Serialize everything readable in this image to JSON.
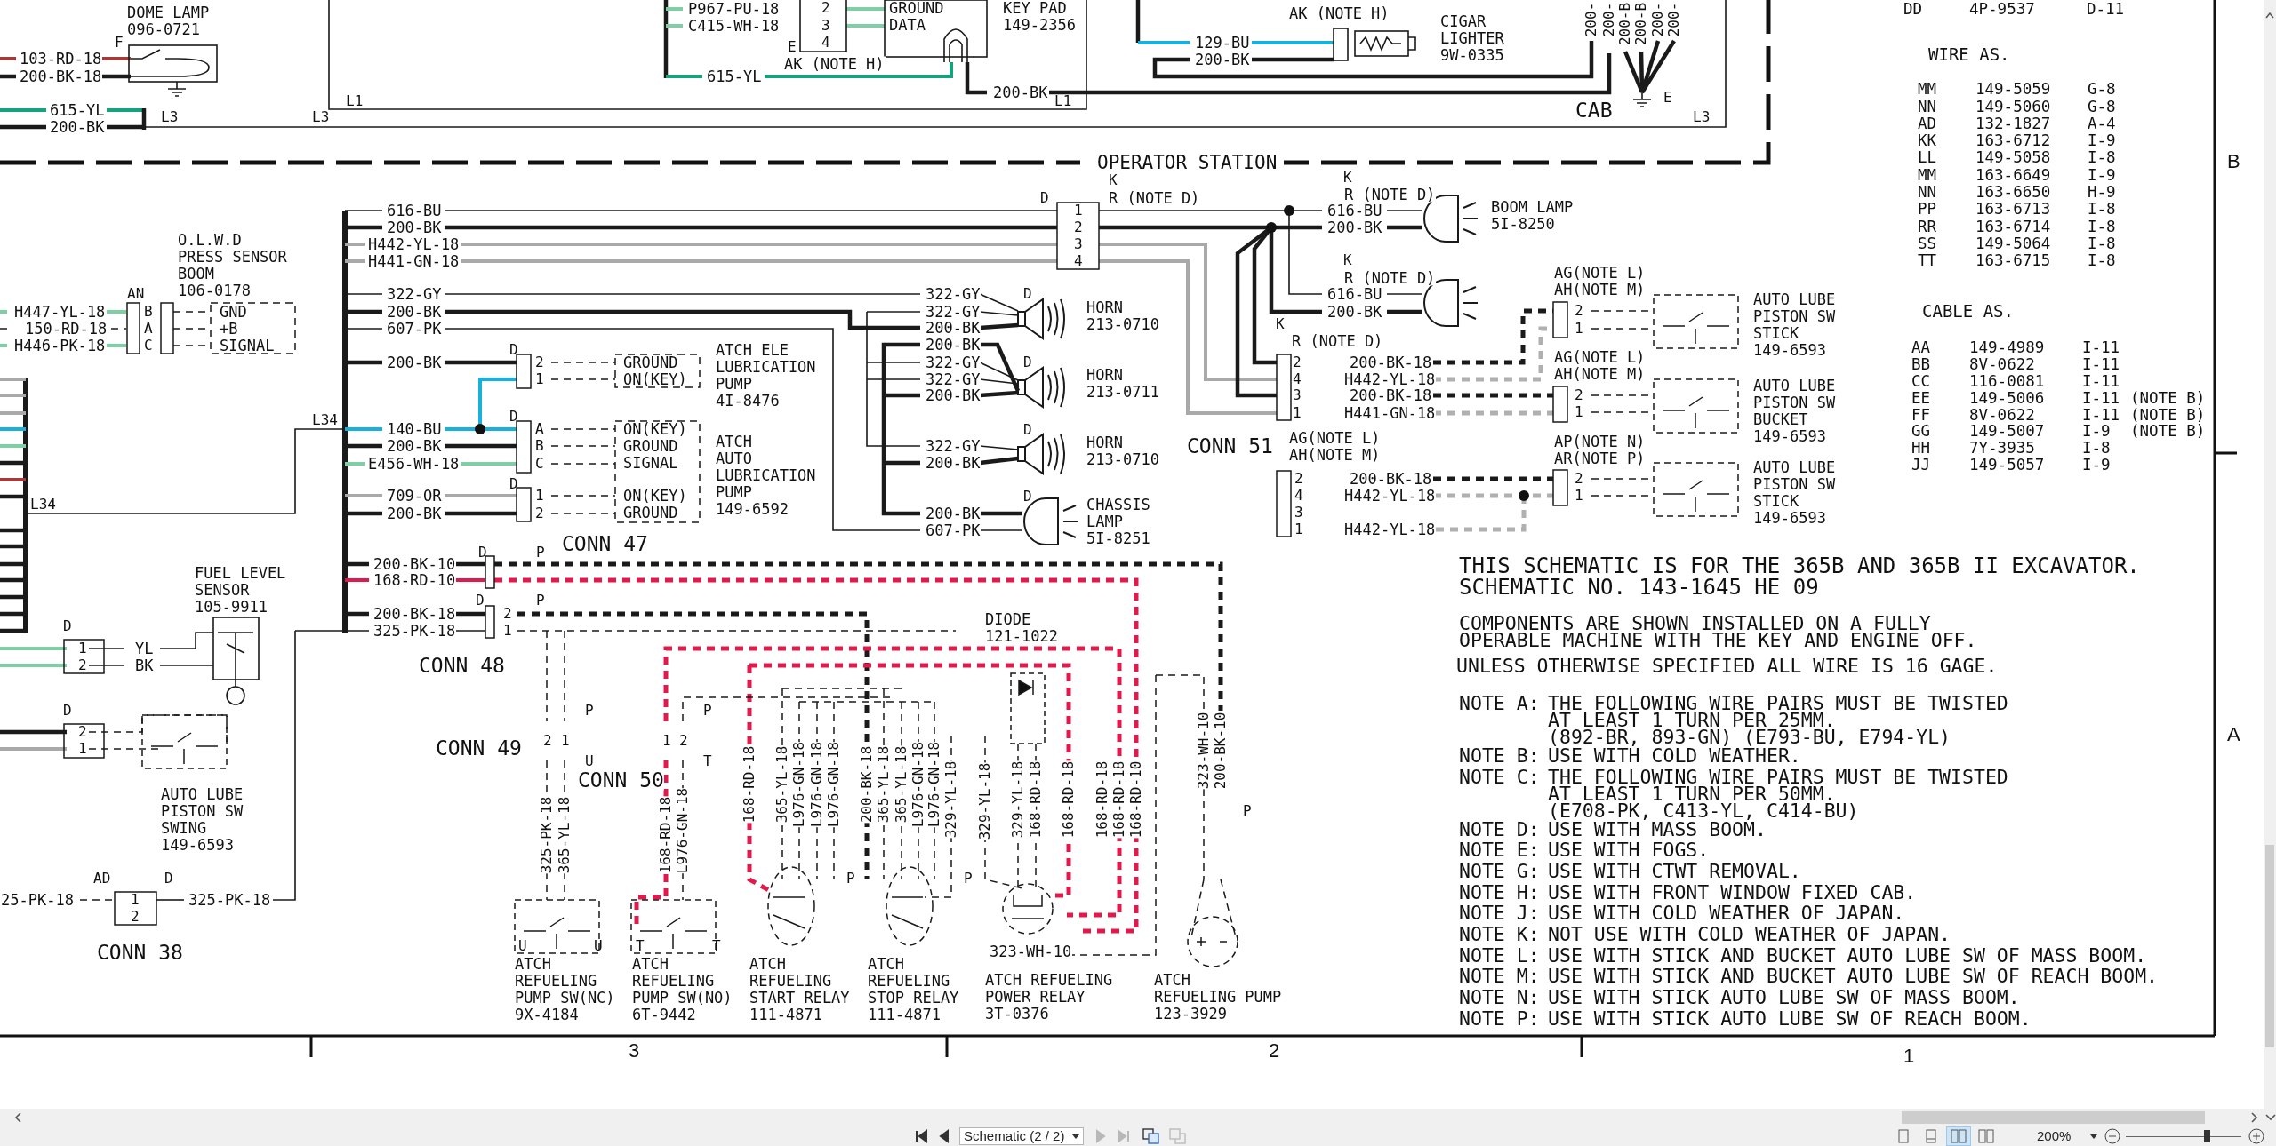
{
  "schematic": {
    "labels": [
      {
        "kind": "name",
        "lines": [
          "DOME LAMP",
          "096-0721"
        ]
      },
      {
        "kind": "pin",
        "text": "F"
      },
      {
        "kind": "wire",
        "text": "103-RD-18"
      },
      {
        "kind": "wire",
        "text": "200-BK-18"
      },
      {
        "kind": "wire",
        "text": "615-YL"
      },
      {
        "kind": "wire",
        "text": "200-BK"
      },
      {
        "kind": "pin",
        "text": "L3"
      },
      {
        "kind": "pin",
        "text": "L3"
      },
      {
        "kind": "pin",
        "text": "L1"
      },
      {
        "kind": "wire",
        "text": "P967-PU-18"
      },
      {
        "kind": "wire",
        "text": "C415-WH-18"
      },
      {
        "kind": "wire",
        "text": "615-YL"
      },
      {
        "kind": "pin",
        "text": "2"
      },
      {
        "kind": "pin",
        "text": "3"
      },
      {
        "kind": "pin",
        "text": "4"
      },
      {
        "kind": "pin",
        "text": "E"
      },
      {
        "kind": "wire",
        "text": "AK (NOTE H)"
      },
      {
        "kind": "name",
        "lines": [
          "GROUND",
          "DATA"
        ]
      },
      {
        "kind": "name",
        "lines": [
          "KEY PAD",
          "149-2356"
        ]
      },
      {
        "kind": "wire",
        "text": "200-BK"
      },
      {
        "kind": "pin",
        "text": "L1"
      },
      {
        "kind": "wire",
        "text": "AK (NOTE H)"
      },
      {
        "kind": "wire",
        "text": "129-BU"
      },
      {
        "kind": "wire",
        "text": "200-BK"
      },
      {
        "kind": "name",
        "lines": [
          "CIGAR",
          "LIGHTER",
          "9W-0335"
        ]
      },
      {
        "kind": "vwire",
        "text": "200-"
      },
      {
        "kind": "vwire",
        "text": "200-"
      },
      {
        "kind": "vwire",
        "text": "200-B"
      },
      {
        "kind": "vwire",
        "text": "200-B"
      },
      {
        "kind": "vwire",
        "text": "200-"
      },
      {
        "kind": "vwire",
        "text": "200-"
      },
      {
        "kind": "conn",
        "text": "CAB"
      },
      {
        "kind": "pin",
        "text": "E"
      },
      {
        "kind": "pin",
        "text": "L3"
      },
      {
        "kind": "title",
        "text": "OPERATOR STATION"
      },
      {
        "kind": "wire",
        "text": "616-BU"
      },
      {
        "kind": "wire",
        "text": "200-BK"
      },
      {
        "kind": "wire",
        "text": "H442-YL-18"
      },
      {
        "kind": "wire",
        "text": "H441-GN-18"
      },
      {
        "kind": "wire",
        "text": "322-GY"
      },
      {
        "kind": "wire",
        "text": "200-BK"
      },
      {
        "kind": "wire",
        "text": "607-PK"
      },
      {
        "kind": "wire",
        "text": "200-BK"
      },
      {
        "kind": "wire",
        "text": "140-BU"
      },
      {
        "kind": "wire",
        "text": "200-BK"
      },
      {
        "kind": "wire",
        "text": "E456-WH-18"
      },
      {
        "kind": "wire",
        "text": "709-OR"
      },
      {
        "kind": "wire",
        "text": "200-BK"
      },
      {
        "kind": "wire",
        "text": "200-BK-10"
      },
      {
        "kind": "wire",
        "text": "168-RD-10"
      },
      {
        "kind": "wire",
        "text": "200-BK-18"
      },
      {
        "kind": "wire",
        "text": "325-PK-18"
      },
      {
        "kind": "pin",
        "text": "L34"
      },
      {
        "kind": "pin",
        "text": "L34"
      },
      {
        "kind": "pin",
        "text": "AN"
      },
      {
        "kind": "name",
        "lines": [
          "O.L.W.D",
          "PRESS SENSOR",
          "BOOM",
          "106-0178"
        ]
      },
      {
        "kind": "wire",
        "text": "H447-YL-18"
      },
      {
        "kind": "wire",
        "text": "150-RD-18"
      },
      {
        "kind": "wire",
        "text": "H446-PK-18"
      },
      {
        "kind": "pin",
        "text": "B"
      },
      {
        "kind": "pin",
        "text": "A"
      },
      {
        "kind": "pin",
        "text": "C"
      },
      {
        "kind": "name",
        "lines": [
          "GND",
          "+B",
          "SIGNAL"
        ]
      },
      {
        "kind": "pin",
        "text": "D"
      },
      {
        "kind": "pin",
        "text": "2"
      },
      {
        "kind": "pin",
        "text": "1"
      },
      {
        "kind": "name",
        "lines": [
          "GROUND",
          "ON(KEY)"
        ]
      },
      {
        "kind": "name",
        "lines": [
          "ATCH ELE",
          "LUBRICATION",
          "PUMP",
          "4I-8476"
        ]
      },
      {
        "kind": "pin",
        "text": "D"
      },
      {
        "kind": "pin",
        "text": "A"
      },
      {
        "kind": "pin",
        "text": "B"
      },
      {
        "kind": "pin",
        "text": "C"
      },
      {
        "kind": "pin",
        "text": "D"
      },
      {
        "kind": "pin",
        "text": "1"
      },
      {
        "kind": "pin",
        "text": "2"
      },
      {
        "kind": "name",
        "lines": [
          "ON(KEY)",
          "GROUND",
          "SIGNAL"
        ]
      },
      {
        "kind": "name",
        "lines": [
          "ON(KEY)",
          "GROUND"
        ]
      },
      {
        "kind": "name",
        "lines": [
          "ATCH",
          "AUTO",
          "LUBRICATION",
          "PUMP",
          "149-6592"
        ]
      },
      {
        "kind": "conn",
        "text": "CONN 47"
      },
      {
        "kind": "pin",
        "text": "D"
      },
      {
        "kind": "pin",
        "text": "P"
      },
      {
        "kind": "pin",
        "text": "D"
      },
      {
        "kind": "pin",
        "text": "P"
      },
      {
        "kind": "pin",
        "text": "2"
      },
      {
        "kind": "pin",
        "text": "1"
      },
      {
        "kind": "conn",
        "text": "CONN 48"
      },
      {
        "kind": "name",
        "lines": [
          "FUEL LEVEL",
          "SENSOR",
          "105-9911"
        ]
      },
      {
        "kind": "pin",
        "text": "D"
      },
      {
        "kind": "pin",
        "text": "1"
      },
      {
        "kind": "pin",
        "text": "2"
      },
      {
        "kind": "wire",
        "text": "YL"
      },
      {
        "kind": "wire",
        "text": "BK"
      },
      {
        "kind": "pin",
        "text": "D"
      },
      {
        "kind": "pin",
        "text": "2"
      },
      {
        "kind": "pin",
        "text": "1"
      },
      {
        "kind": "name",
        "lines": [
          "AUTO LUBE",
          "PISTON SW",
          "SWING",
          "149-6593"
        ]
      },
      {
        "kind": "pin",
        "text": "AD"
      },
      {
        "kind": "pin",
        "text": "D"
      },
      {
        "kind": "wire",
        "text": "25-PK-18"
      },
      {
        "kind": "pin",
        "text": "1"
      },
      {
        "kind": "pin",
        "text": "2"
      },
      {
        "kind": "wire",
        "text": "325-PK-18"
      },
      {
        "kind": "conn",
        "text": "CONN 38"
      },
      {
        "kind": "pin",
        "text": "P"
      },
      {
        "kind": "pin",
        "text": "2"
      },
      {
        "kind": "pin",
        "text": "1"
      },
      {
        "kind": "pin",
        "text": "U"
      },
      {
        "kind": "conn",
        "text": "CONN 49"
      },
      {
        "kind": "vwire",
        "text": "325-PK-18"
      },
      {
        "kind": "vwire",
        "text": "365-YL-18"
      },
      {
        "kind": "pin",
        "text": "1"
      },
      {
        "kind": "pin",
        "text": "2"
      },
      {
        "kind": "pin",
        "text": "P"
      },
      {
        "kind": "pin",
        "text": "T"
      },
      {
        "kind": "conn",
        "text": "CONN 50"
      },
      {
        "kind": "vwire",
        "text": "168-RD-18"
      },
      {
        "kind": "vwire",
        "text": "L976-GN-18"
      },
      {
        "kind": "pin",
        "text": "U"
      },
      {
        "kind": "pin",
        "text": "U"
      },
      {
        "kind": "pin",
        "text": "T"
      },
      {
        "kind": "pin",
        "text": "T"
      },
      {
        "kind": "name",
        "lines": [
          "ATCH",
          "REFUELING",
          "PUMP SW(NC)",
          "9X-4184"
        ]
      },
      {
        "kind": "name",
        "lines": [
          "ATCH",
          "REFUELING",
          "PUMP SW(NO)",
          "6T-9442"
        ]
      },
      {
        "kind": "vwire",
        "text": "168-RD-18"
      },
      {
        "kind": "vwire",
        "text": "365-YL-18"
      },
      {
        "kind": "vwire",
        "text": "L976-GN-18"
      },
      {
        "kind": "vwire",
        "text": "L976-GN-18"
      },
      {
        "kind": "vwire",
        "text": "L976-GN-18"
      },
      {
        "kind": "vwire",
        "text": "200-BK-18"
      },
      {
        "kind": "vwire",
        "text": "365-YL-18"
      },
      {
        "kind": "vwire",
        "text": "365-YL-18"
      },
      {
        "kind": "vwire",
        "text": "L976-GN-18"
      },
      {
        "kind": "vwire",
        "text": "L976-GN-18"
      },
      {
        "kind": "vwire",
        "text": "329-YL-18"
      },
      {
        "kind": "vwire",
        "text": "329-YL-18"
      },
      {
        "kind": "vwire",
        "text": "329-YL-18"
      },
      {
        "kind": "vwire",
        "text": "168-RD-18"
      },
      {
        "kind": "vwire",
        "text": "168-RD-18"
      },
      {
        "kind": "vwire",
        "text": "168-RD-18"
      },
      {
        "kind": "vwire",
        "text": "168-RD-18"
      },
      {
        "kind": "vwire",
        "text": "168-RD-10"
      },
      {
        "kind": "vwire",
        "text": "323-WH-10"
      },
      {
        "kind": "vwire",
        "text": "200-BK-10"
      },
      {
        "kind": "pin",
        "text": "P"
      },
      {
        "kind": "pin",
        "text": "P"
      },
      {
        "kind": "pin",
        "text": "P"
      },
      {
        "kind": "name",
        "lines": [
          "DIODE",
          "121-1022"
        ]
      },
      {
        "kind": "wire",
        "text": "323-WH-10"
      },
      {
        "kind": "name",
        "lines": [
          "ATCH",
          "REFUELING",
          "START RELAY",
          "111-4871"
        ]
      },
      {
        "kind": "name",
        "lines": [
          "ATCH",
          "REFUELING",
          "STOP RELAY",
          "111-4871"
        ]
      },
      {
        "kind": "name",
        "lines": [
          "ATCH REFUELING",
          "POWER RELAY",
          "3T-0376"
        ]
      },
      {
        "kind": "name",
        "lines": [
          "ATCH",
          "REFUELING PUMP",
          "123-3929"
        ]
      },
      {
        "kind": "pin",
        "text": "D"
      },
      {
        "kind": "pin",
        "text": "K"
      },
      {
        "kind": "wire",
        "text": "R (NOTE D)"
      },
      {
        "kind": "pin",
        "text": "1"
      },
      {
        "kind": "pin",
        "text": "2"
      },
      {
        "kind": "pin",
        "text": "3"
      },
      {
        "kind": "pin",
        "text": "4"
      },
      {
        "kind": "pin",
        "text": "K"
      },
      {
        "kind": "wire",
        "text": "R (NOTE D)"
      },
      {
        "kind": "wire",
        "text": "616-BU"
      },
      {
        "kind": "wire",
        "text": "200-BK"
      },
      {
        "kind": "name",
        "lines": [
          "BOOM LAMP",
          "5I-8250"
        ]
      },
      {
        "kind": "pin",
        "text": "K"
      },
      {
        "kind": "wire",
        "text": "R (NOTE D)"
      },
      {
        "kind": "wire",
        "text": "616-BU"
      },
      {
        "kind": "wire",
        "text": "200-BK"
      },
      {
        "kind": "wire",
        "text": "322-GY"
      },
      {
        "kind": "wire",
        "text": "322-GY"
      },
      {
        "kind": "wire",
        "text": "200-BK"
      },
      {
        "kind": "wire",
        "text": "200-BK"
      },
      {
        "kind": "wire",
        "text": "322-GY"
      },
      {
        "kind": "wire",
        "text": "322-GY"
      },
      {
        "kind": "wire",
        "text": "200-BK"
      },
      {
        "kind": "wire",
        "text": "322-GY"
      },
      {
        "kind": "wire",
        "text": "200-BK"
      },
      {
        "kind": "wire",
        "text": "200-BK"
      },
      {
        "kind": "wire",
        "text": "607-PK"
      },
      {
        "kind": "pin",
        "text": "D"
      },
      {
        "kind": "pin",
        "text": "D"
      },
      {
        "kind": "pin",
        "text": "D"
      },
      {
        "kind": "pin",
        "text": "D"
      },
      {
        "kind": "name",
        "lines": [
          "HORN",
          "213-0710"
        ]
      },
      {
        "kind": "name",
        "lines": [
          "HORN",
          "213-0711"
        ]
      },
      {
        "kind": "name",
        "lines": [
          "HORN",
          "213-0710"
        ]
      },
      {
        "kind": "name",
        "lines": [
          "CHASSIS",
          "LAMP",
          "5I-8251"
        ]
      },
      {
        "kind": "pin",
        "text": "K"
      },
      {
        "kind": "wire",
        "text": "R (NOTE D)"
      },
      {
        "kind": "pin",
        "text": "2"
      },
      {
        "kind": "pin",
        "text": "4"
      },
      {
        "kind": "pin",
        "text": "3"
      },
      {
        "kind": "pin",
        "text": "1"
      },
      {
        "kind": "wire",
        "text": "200-BK-18"
      },
      {
        "kind": "wire",
        "text": "H442-YL-18"
      },
      {
        "kind": "wire",
        "text": "200-BK-18"
      },
      {
        "kind": "wire",
        "text": "H441-GN-18"
      },
      {
        "kind": "conn",
        "text": "CONN 51"
      },
      {
        "kind": "wire",
        "text": "AG(NOTE L)"
      },
      {
        "kind": "wire",
        "text": "AH(NOTE M)"
      },
      {
        "kind": "pin",
        "text": "2"
      },
      {
        "kind": "pin",
        "text": "4"
      },
      {
        "kind": "pin",
        "text": "3"
      },
      {
        "kind": "pin",
        "text": "1"
      },
      {
        "kind": "wire",
        "text": "200-BK-18"
      },
      {
        "kind": "wire",
        "text": "H442-YL-18"
      },
      {
        "kind": "wire",
        "text": "H442-YL-18"
      },
      {
        "kind": "wire",
        "text": "AG(NOTE L)"
      },
      {
        "kind": "wire",
        "text": "AH(NOTE M)"
      },
      {
        "kind": "pin",
        "text": "2"
      },
      {
        "kind": "pin",
        "text": "1"
      },
      {
        "kind": "name",
        "lines": [
          "AUTO LUBE",
          "PISTON SW",
          "STICK",
          "149-6593"
        ]
      },
      {
        "kind": "wire",
        "text": "AG(NOTE L)"
      },
      {
        "kind": "wire",
        "text": "AH(NOTE M)"
      },
      {
        "kind": "pin",
        "text": "2"
      },
      {
        "kind": "pin",
        "text": "1"
      },
      {
        "kind": "name",
        "lines": [
          "AUTO LUBE",
          "PISTON SW",
          "BUCKET",
          "149-6593"
        ]
      },
      {
        "kind": "wire",
        "text": "AP(NOTE N)"
      },
      {
        "kind": "wire",
        "text": "AR(NOTE P)"
      },
      {
        "kind": "pin",
        "text": "2"
      },
      {
        "kind": "pin",
        "text": "1"
      },
      {
        "kind": "name",
        "lines": [
          "AUTO LUBE",
          "PISTON SW",
          "STICK",
          "149-6593"
        ]
      },
      {
        "kind": "grid",
        "text": "B"
      },
      {
        "kind": "grid",
        "text": "A"
      },
      {
        "kind": "grid",
        "text": "3"
      },
      {
        "kind": "grid",
        "text": "2"
      },
      {
        "kind": "grid",
        "text": "1"
      }
    ]
  },
  "previous_table_rows": [
    {
      "code": "DD",
      "part": "4P-9537",
      "zone": "D-11"
    }
  ],
  "wire_table": {
    "title": "WIRE AS.",
    "rows": [
      {
        "code": "MM",
        "part": "149-5059",
        "zone": "G-8"
      },
      {
        "code": "NN",
        "part": "149-5060",
        "zone": "G-8"
      },
      {
        "code": "AD",
        "part": "132-1827",
        "zone": "A-4"
      },
      {
        "code": "KK",
        "part": "163-6712",
        "zone": "I-9"
      },
      {
        "code": "LL",
        "part": "149-5058",
        "zone": "I-8"
      },
      {
        "code": "MM",
        "part": "163-6649",
        "zone": "I-9"
      },
      {
        "code": "NN",
        "part": "163-6650",
        "zone": "H-9"
      },
      {
        "code": "PP",
        "part": "163-6713",
        "zone": "I-8"
      },
      {
        "code": "RR",
        "part": "163-6714",
        "zone": "I-8"
      },
      {
        "code": "SS",
        "part": "149-5064",
        "zone": "I-8"
      },
      {
        "code": "TT",
        "part": "163-6715",
        "zone": "I-8"
      }
    ]
  },
  "cable_table": {
    "title": "CABLE AS.",
    "rows": [
      {
        "code": "AA",
        "part": "149-4989",
        "zone": "I-11"
      },
      {
        "code": "BB",
        "part": "8V-0622",
        "zone": "I-11"
      },
      {
        "code": "CC",
        "part": "116-0081",
        "zone": "I-11"
      },
      {
        "code": "EE",
        "part": "149-5006",
        "zone": "I-11",
        "note": "(NOTE B)"
      },
      {
        "code": "FF",
        "part": "8V-0622",
        "zone": "I-11",
        "note": "(NOTE B)"
      },
      {
        "code": "GG",
        "part": "149-5007",
        "zone": "I-9",
        "note": "(NOTE B)"
      },
      {
        "code": "HH",
        "part": "7Y-3935",
        "zone": "I-8"
      },
      {
        "code": "JJ",
        "part": "149-5057",
        "zone": "I-9"
      }
    ]
  },
  "notes": {
    "heading": [
      "THIS SCHEMATIC IS FOR THE 365B AND 365B II EXCAVATOR.",
      "SCHEMATIC NO. 143-1645 HE 09"
    ],
    "conditions": [
      "COMPONENTS ARE SHOWN INSTALLED ON A FULLY",
      "OPERABLE MACHINE WITH THE KEY AND ENGINE OFF."
    ],
    "gage": "UNLESS OTHERWISE SPECIFIED ALL WIRE IS 16 GAGE.",
    "items": [
      {
        "label": "NOTE A:",
        "lines": [
          "THE FOLLOWING WIRE PAIRS MUST BE TWISTED",
          "AT LEAST 1 TURN PER 25MM.",
          "(892-BR, 893-GN) (E793-BU, E794-YL)"
        ]
      },
      {
        "label": "NOTE B:",
        "lines": [
          "USE WITH COLD WEATHER."
        ]
      },
      {
        "label": "NOTE C:",
        "lines": [
          "THE FOLLOWING WIRE PAIRS MUST BE TWISTED",
          "AT LEAST 1 TURN PER 50MM.",
          "(E708-PK, C413-YL, C414-BU)"
        ]
      },
      {
        "label": "NOTE D:",
        "lines": [
          "USE WITH MASS BOOM."
        ]
      },
      {
        "label": "NOTE E:",
        "lines": [
          "USE WITH FOGS."
        ]
      },
      {
        "label": "NOTE G:",
        "lines": [
          "USE WITH CTWT REMOVAL."
        ]
      },
      {
        "label": "NOTE H:",
        "lines": [
          "USE WITH FRONT WINDOW FIXED CAB."
        ]
      },
      {
        "label": "NOTE J:",
        "lines": [
          "USE WITH COLD WEATHER OF JAPAN."
        ]
      },
      {
        "label": "NOTE K:",
        "lines": [
          "NOT USE WITH COLD WEATHER OF JAPAN."
        ]
      },
      {
        "label": "NOTE L:",
        "lines": [
          "USE WITH STICK AND BUCKET AUTO LUBE SW OF MASS BOOM."
        ]
      },
      {
        "label": "NOTE M:",
        "lines": [
          "USE WITH STICK AND BUCKET AUTO LUBE SW OF REACH BOOM."
        ]
      },
      {
        "label": "NOTE N:",
        "lines": [
          "USE WITH STICK AUTO LUBE SW OF MASS BOOM."
        ]
      },
      {
        "label": "NOTE P:",
        "lines": [
          "USE WITH STICK AUTO LUBE SW OF REACH BOOM."
        ]
      }
    ]
  },
  "viewer": {
    "nav_buttons": [
      {
        "kind": "first",
        "disabled": false
      },
      {
        "kind": "prev",
        "disabled": false
      },
      {
        "kind": "next",
        "disabled": true
      },
      {
        "kind": "last",
        "disabled": true
      }
    ],
    "page_selector": "Schematic (2 / 2)",
    "page_tools": [
      {
        "kind": "extract",
        "disabled": false
      },
      {
        "kind": "insert",
        "disabled": true
      }
    ],
    "view_modes": [
      {
        "kind": "single",
        "selected": false
      },
      {
        "kind": "continuous",
        "selected": false
      },
      {
        "kind": "facing",
        "selected": true
      },
      {
        "kind": "cover",
        "selected": false
      }
    ],
    "zoom_text": "200%",
    "zoom_slider": {
      "level": 0.7
    }
  }
}
